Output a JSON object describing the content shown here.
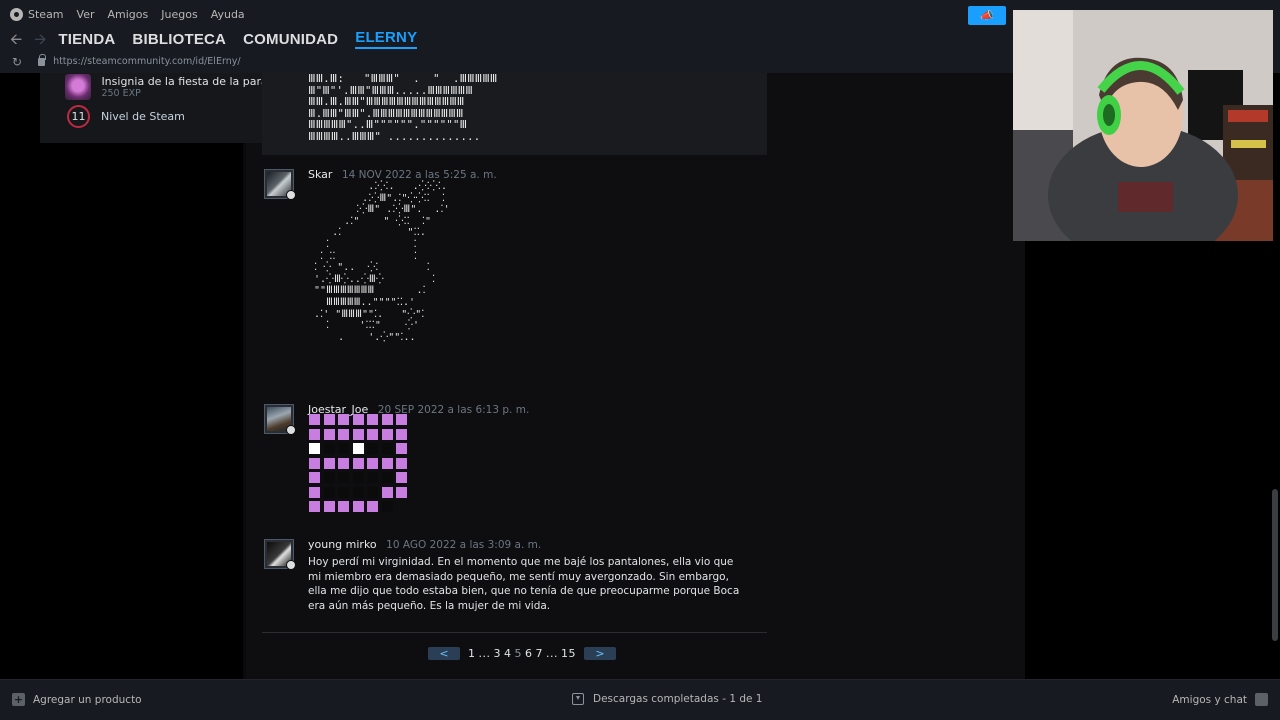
{
  "menu": {
    "app_name": "Steam",
    "items": [
      "Ver",
      "Amigos",
      "Juegos",
      "Ayuda"
    ]
  },
  "nav": {
    "back_arrow": "arrow-left-icon",
    "forward_arrow": "arrow-right-icon",
    "links": [
      "TIENDA",
      "BIBLIOTECA",
      "COMUNIDAD",
      "ELERNY"
    ],
    "active": "ELERNY"
  },
  "url": {
    "value": "https://steamcommunity.com/id/ElErny/"
  },
  "profile": {
    "badge_title": "Insignia de la fiesta de la paradoj...",
    "badge_exp": "250 EXP",
    "level": "11",
    "level_label": "Nivel de Steam"
  },
  "comments": [
    {
      "author": "Skar",
      "date": "14 NOV 2022 a las 5:25 a. m."
    },
    {
      "author": "Joestar_Joe",
      "date": "20 SEP 2022 a las 6:13 p. m."
    },
    {
      "author": "young mirko",
      "date": "10 AGO 2022 a las 3:09 a. m.",
      "text": "Hoy perdí mi virginidad. En el momento que me bajé los pantalones, ella vio que mi miembro era demasiado pequeño, me sentí muy avergonzado. Sin embargo, ella me dijo que todo estaba bien, que no tenía de que preocuparme porque Boca era aún más pequeño. Es la mujer de mi vida."
    }
  ],
  "pagination": {
    "prev": "<",
    "next": ">",
    "p1": "1",
    "gap1": "...",
    "p3": "3",
    "p4": "4",
    "current": "5",
    "p6": "6",
    "p7": "7",
    "gap2": "...",
    "last": "15"
  },
  "bottom": {
    "add_product": "Agregar un producto",
    "downloads": "Descargas completadas - 1 de 1",
    "friends": "Amigos y chat"
  },
  "colors": {
    "accent": "#1a9fff",
    "pixel_purple": "#c77ee0",
    "level_ring": "#c02942"
  }
}
